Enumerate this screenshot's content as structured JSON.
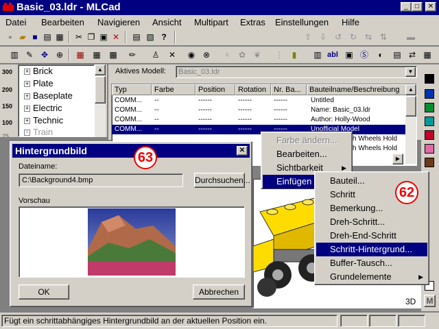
{
  "window": {
    "title": "Basic_03.ldr - MLCad",
    "min": "_",
    "max": "□",
    "close": "✕"
  },
  "menu": [
    "Datei",
    "Bearbeiten",
    "Navigieren",
    "Ansicht",
    "Multipart",
    "Extras",
    "Einstellungen",
    "Hilfe"
  ],
  "toolbar1": [
    "new-file",
    "open",
    "save",
    "print",
    "cut",
    "copy",
    "paste",
    "delete",
    "properties",
    "help",
    "move-up",
    "move-down",
    "move-left",
    "move-right",
    "rotate-left",
    "rotate-right",
    "mirror",
    "flip",
    "brick"
  ],
  "toolbar2": [
    "model",
    "edit",
    "move",
    "zoom",
    "grid-1",
    "grid-2",
    "grid-3",
    "color",
    "minifig",
    "cross",
    "step",
    "step-end",
    "bulb",
    "gear",
    "paint",
    "grid-snap",
    "brick-2",
    "group",
    "text",
    "bg",
    "search",
    "ghost",
    "export",
    "buffer",
    "file"
  ],
  "zoom_labels": [
    "300",
    "200",
    "150",
    "100",
    "75"
  ],
  "tree": {
    "items": [
      "Brick",
      "Plate",
      "Baseplate",
      "Electric",
      "Technic",
      "Train"
    ]
  },
  "model": {
    "label": "Aktives Modell:",
    "value": "Basic_03.ldr"
  },
  "grid": {
    "headers": [
      "Typ",
      "Farbe",
      "Position",
      "Rotation",
      "Nr. Ba...",
      "Bauteilname/Beschreibung"
    ],
    "rows": [
      [
        "COMM...",
        "--",
        "------",
        "------",
        "------",
        "Untitled"
      ],
      [
        "COMM...",
        "--",
        "------",
        "------",
        "------",
        "Name: Basic_03.ldr"
      ],
      [
        "COMM...",
        "--",
        "------",
        "------",
        "------",
        "Author: Holly-Wood"
      ],
      [
        "COMM...",
        "--",
        "------",
        "------",
        "------",
        "Unofficial Model"
      ],
      [
        "",
        "",
        "",
        "",
        "",
        "ith Wheels Hold"
      ],
      [
        "",
        "",
        "",
        "",
        "",
        "ith Wheels Hold"
      ]
    ]
  },
  "context_menu": {
    "items": [
      {
        "label": "Farbe ändern...",
        "disabled": true
      },
      {
        "label": "Bearbeiten..."
      },
      {
        "label": "Sichtbarkeit",
        "submenu": true
      },
      {
        "label": "Einfügen",
        "highlighted": true,
        "submenu": true
      }
    ]
  },
  "submenu": {
    "items": [
      "Bauteil...",
      "Schritt",
      "Bemerkung...",
      "Dreh-Schritt...",
      "Dreh-End-Schritt",
      "Schritt-Hintergrund...",
      "Buffer-Tausch...",
      "Grundelemente"
    ],
    "highlighted": 5
  },
  "dialog": {
    "title": "Hintergrundbild",
    "file_label": "Dateiname:",
    "file_value": "C:\\Background4.bmp",
    "browse": "Durchsuchen...",
    "preview_label": "Vorschau",
    "ok": "OK",
    "cancel": "Abbrechen"
  },
  "badges": {
    "dialog": "63",
    "menu": "62"
  },
  "view_label": "3D",
  "palette_colors": [
    "#000000",
    "#0033b2",
    "#008f2f",
    "#009b9b",
    "#c4002b",
    "#e06ba8",
    "#6b3a1a",
    "#ffffff"
  ],
  "palette_bottom": "M",
  "status": {
    "text": "Fügt ein schrittabhängiges Hintergrundbild an der aktuellen Position ein."
  }
}
